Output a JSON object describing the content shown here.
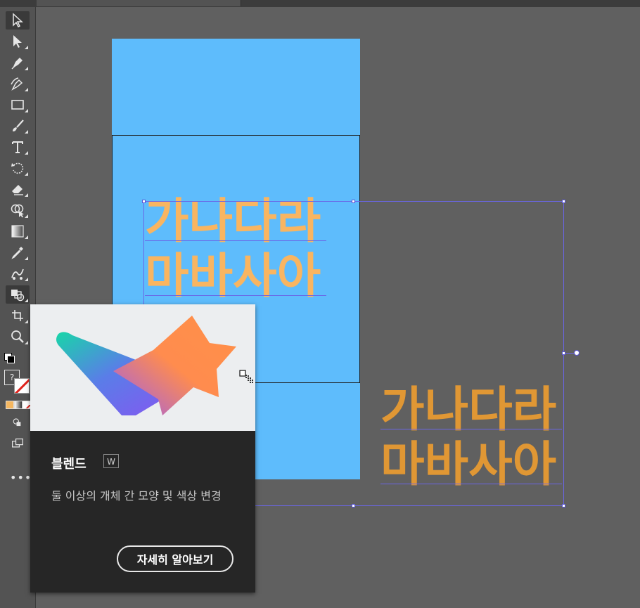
{
  "canvas": {
    "text_block_1": {
      "line1": "가나다라",
      "line2": "마바사아",
      "color": "#f9b561"
    },
    "text_block_2": {
      "line1": "가나다라",
      "line2": "마바사아",
      "color": "#e09734"
    },
    "artboard_color": "#5ebcfc",
    "selection_color": "#6a66e6"
  },
  "toolbar": {
    "tools": [
      "selection-tool-icon",
      "direct-selection-tool-icon",
      "pen-tool-icon",
      "curvature-tool-icon",
      "rectangle-tool-icon",
      "paintbrush-tool-icon",
      "type-tool-icon",
      "rotate-tool-icon",
      "eraser-tool-icon",
      "shape-builder-tool-icon",
      "gradient-tool-icon",
      "eyedropper-tool-icon",
      "puppet-warp-tool-icon",
      "blend-tool-icon",
      "artboard-tool-icon",
      "zoom-tool-icon"
    ],
    "question_mark": "?",
    "more_label": "•••"
  },
  "tooltip": {
    "title": "블렌드",
    "shortcut": "W",
    "description": "둘 이상의 개체 간 모양 및 색상 변경",
    "learn_more_label": "자세히 알아보기"
  }
}
